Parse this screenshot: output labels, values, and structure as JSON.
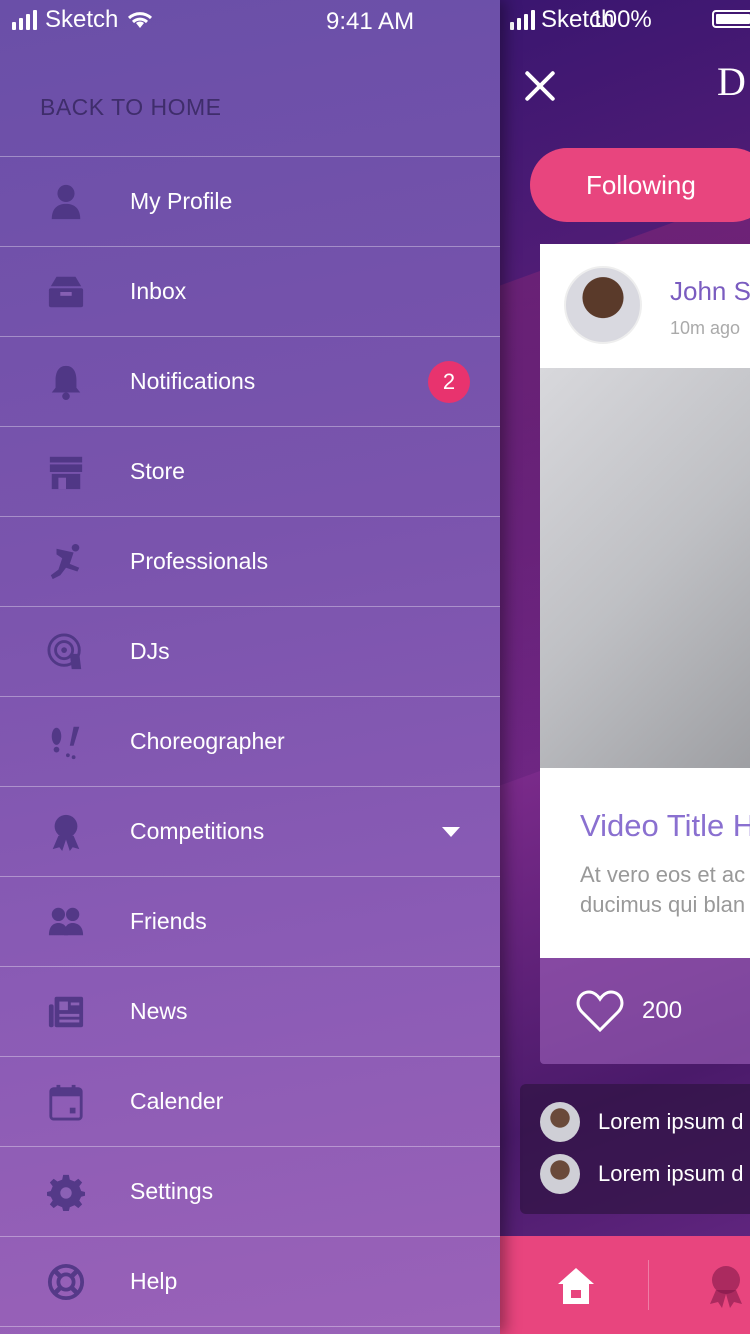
{
  "status_bar": {
    "carrier": "Sketch",
    "time": "9:41 AM",
    "battery": "100%"
  },
  "drawer": {
    "back_label": "BACK TO HOME",
    "items": [
      {
        "label": "My Profile",
        "icon": "user-icon"
      },
      {
        "label": "Inbox",
        "icon": "inbox-icon"
      },
      {
        "label": "Notifications",
        "icon": "bell-icon",
        "badge": "2"
      },
      {
        "label": "Store",
        "icon": "store-icon"
      },
      {
        "label": "Professionals",
        "icon": "dancer-icon"
      },
      {
        "label": "DJs",
        "icon": "turntable-icon"
      },
      {
        "label": "Choreographer",
        "icon": "footsteps-icon"
      },
      {
        "label": "Competitions",
        "icon": "award-icon"
      },
      {
        "label": "Friends",
        "icon": "friends-icon"
      },
      {
        "label": "News",
        "icon": "newspaper-icon"
      },
      {
        "label": "Calender",
        "icon": "calendar-icon"
      },
      {
        "label": "Settings",
        "icon": "gear-icon"
      },
      {
        "label": "Help",
        "icon": "lifebuoy-icon"
      }
    ]
  },
  "main": {
    "logo_letter": "D",
    "following_label": "Following",
    "post": {
      "user": "John S",
      "time": "10m ago",
      "video_title": "Video Title H",
      "text_line1": "At vero eos et ac",
      "text_line2": "ducimus qui blan",
      "likes": "200"
    },
    "comments": [
      "Lorem ipsum d",
      "Lorem ipsum d"
    ]
  },
  "colors": {
    "accent": "#e8457e",
    "badge": "#e8336e",
    "drawer_top": "#6a4fa8",
    "drawer_bottom": "#9a62b8"
  }
}
